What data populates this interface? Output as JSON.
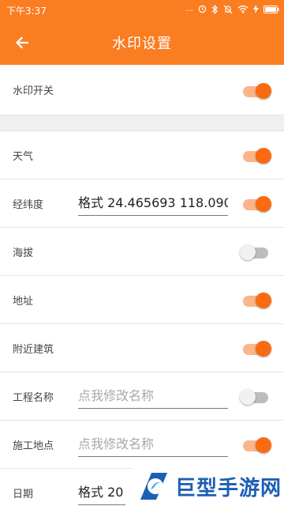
{
  "status_bar": {
    "time": "下午3:37",
    "icons": [
      "more-dots-icon",
      "alarm-icon",
      "bluetooth-icon",
      "silent-icon",
      "wifi-icon",
      "charging-icon",
      "battery-icon"
    ]
  },
  "app_bar": {
    "title": "水印设置",
    "back_icon": "arrow-left-icon"
  },
  "colors": {
    "accent": "#fa7d22",
    "toggle_on_thumb": "#fa6a10",
    "toggle_on_track": "#fbb58a",
    "toggle_off_track": "#bdbdbd"
  },
  "settings": {
    "master": {
      "label": "水印开关",
      "enabled": true
    },
    "weather": {
      "label": "天气",
      "enabled": true
    },
    "coords": {
      "label": "经纬度",
      "value": "格式 24.465693 118.090",
      "enabled": true
    },
    "altitude": {
      "label": "海拔",
      "enabled": false
    },
    "address": {
      "label": "地址",
      "enabled": true
    },
    "nearby": {
      "label": "附近建筑",
      "enabled": true
    },
    "project": {
      "label": "工程名称",
      "placeholder": "点我修改名称",
      "enabled": false
    },
    "site": {
      "label": "施工地点",
      "placeholder": "点我修改名称",
      "enabled": true
    },
    "date": {
      "label": "日期",
      "value": "格式 20"
    }
  },
  "watermark": {
    "brand": "巨型手游网"
  }
}
